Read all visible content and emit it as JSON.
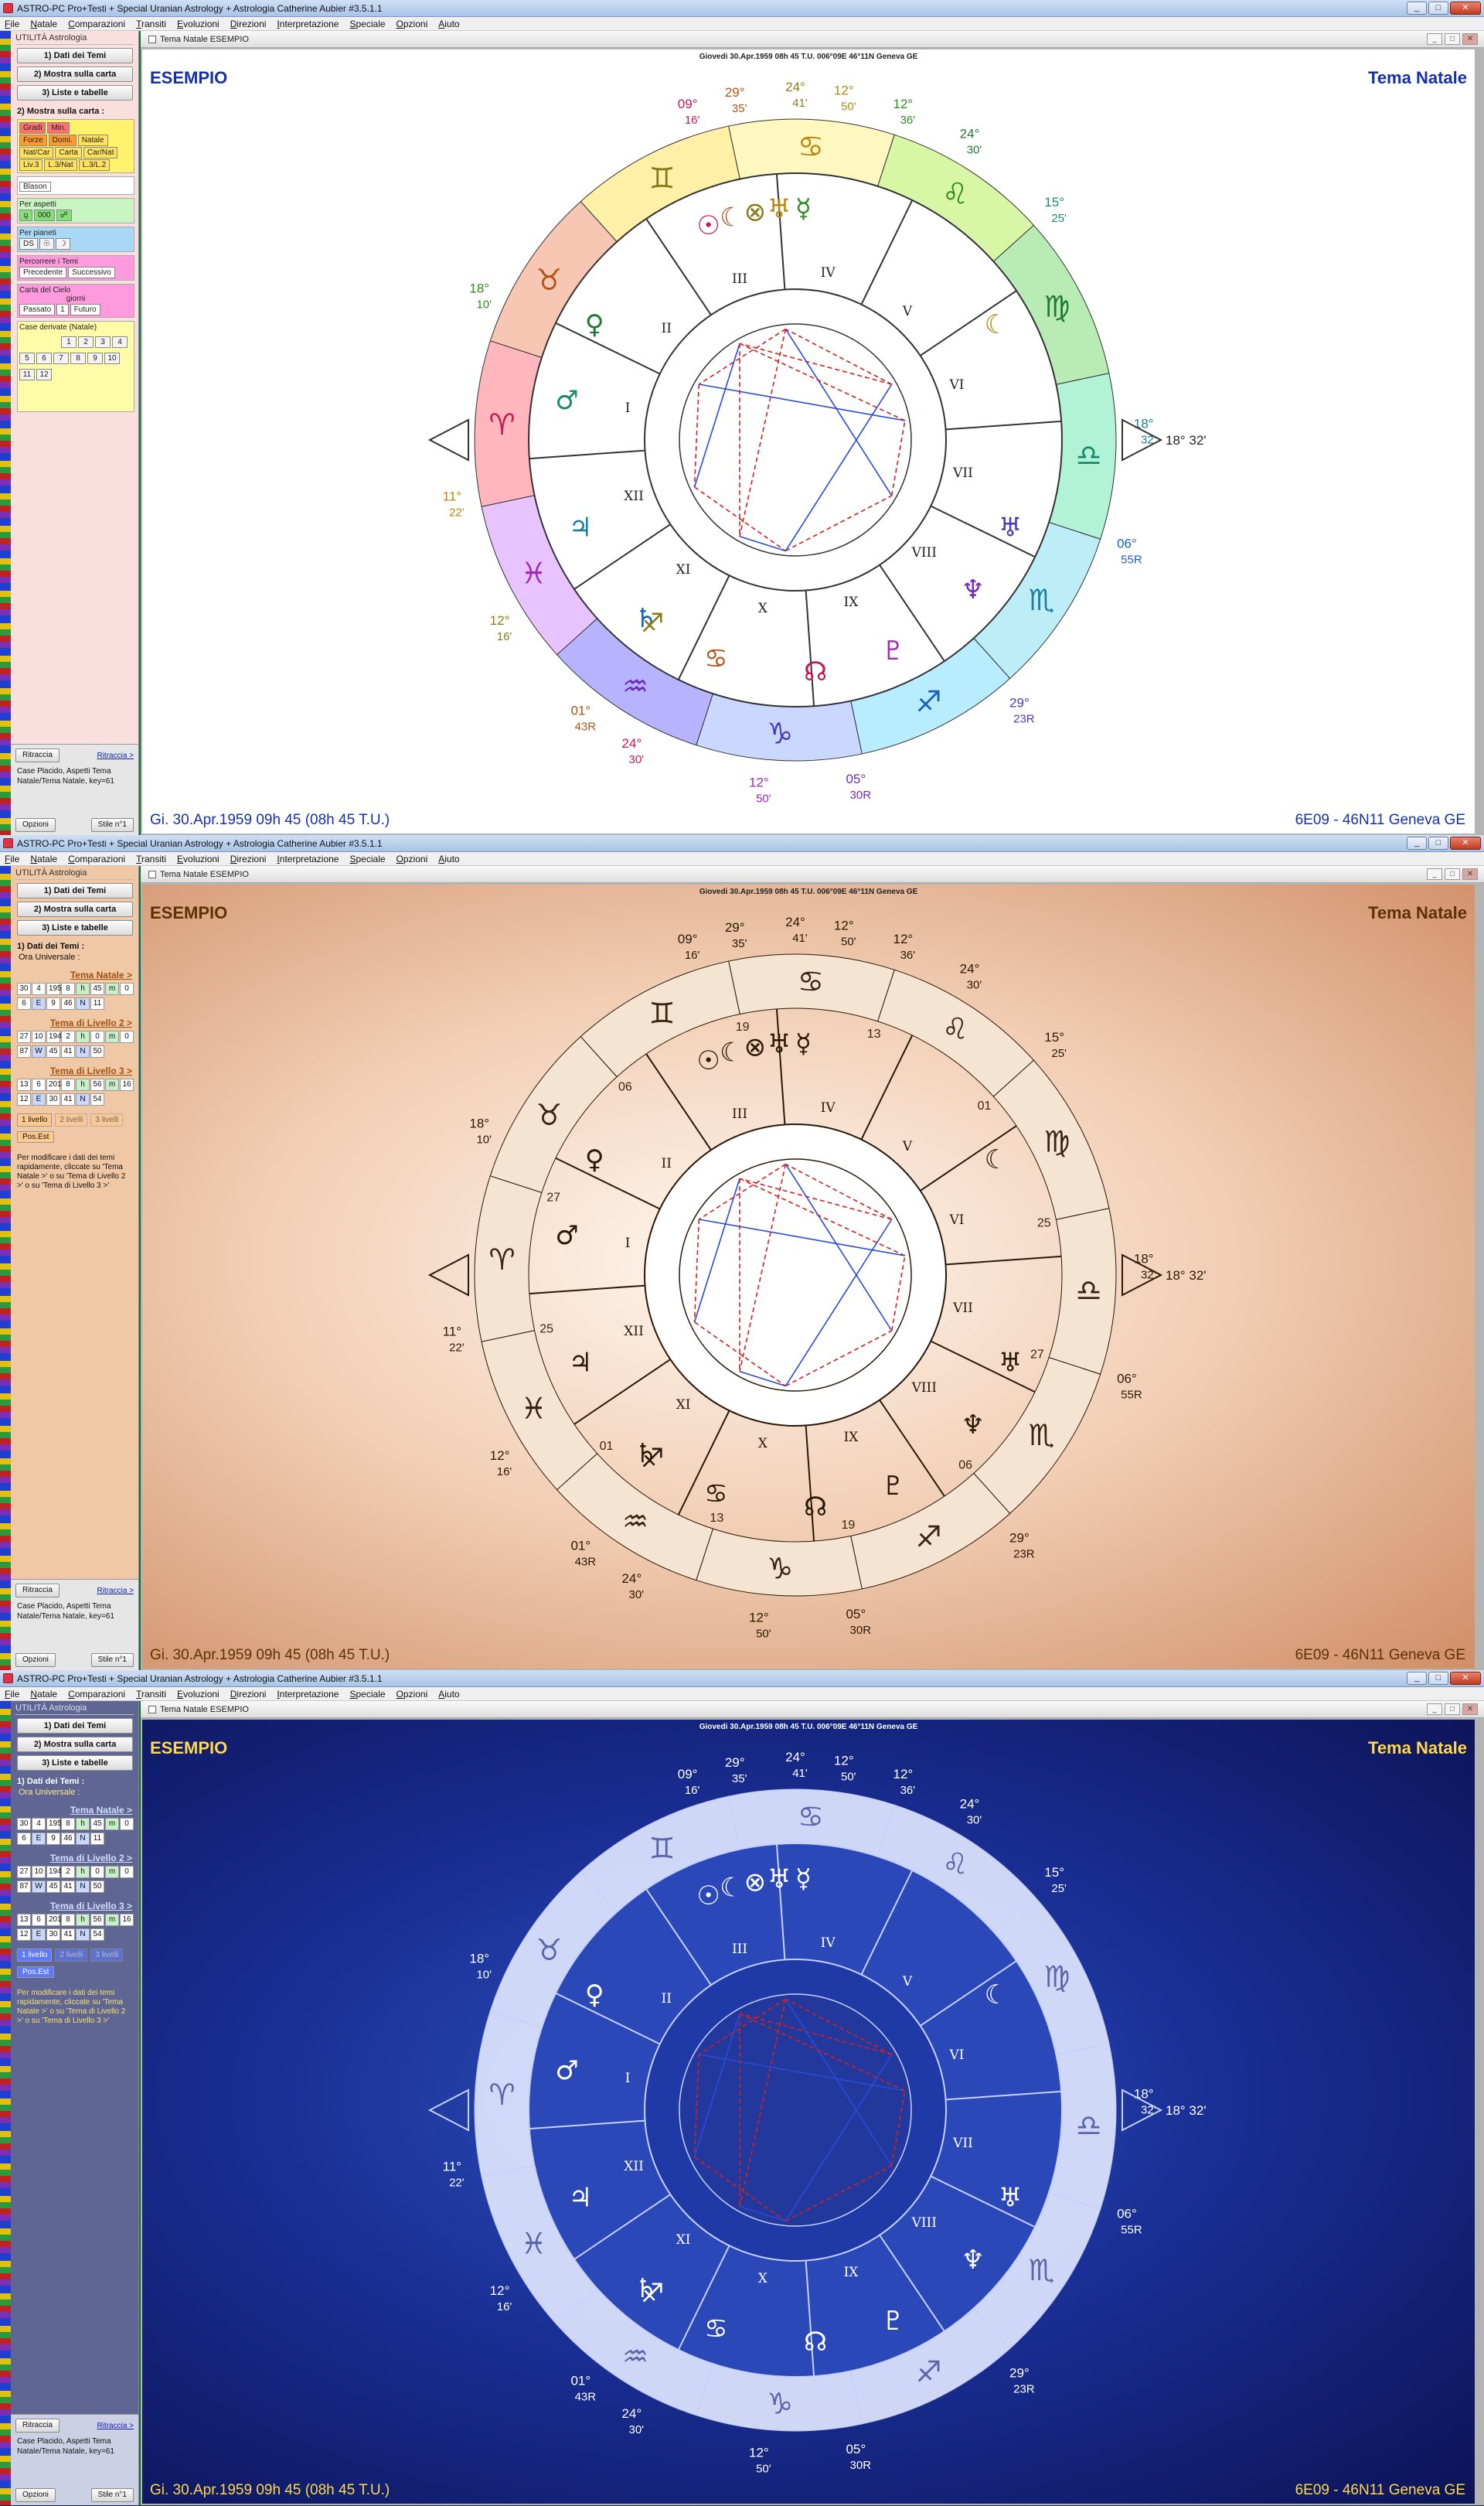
{
  "app": {
    "window_title": "ASTRO-PC Pro+Testi + Special Uranian Astrology + Astrologia Catherine Aubier #3.5.1.1",
    "menu": [
      "File",
      "Natale",
      "Comparazioni",
      "Transiti",
      "Evoluzioni",
      "Direzioni",
      "Interpretazione",
      "Speciale",
      "Opzioni",
      "Aiuto"
    ],
    "window_buttons": {
      "min": "_",
      "max": "□",
      "close": "✕"
    }
  },
  "left_panel": {
    "header": "UTILITÀ Astrologia",
    "nav_buttons": [
      "1) Dati dei Temi",
      "2) Mostra sulla carta",
      "3) Liste e tabelle"
    ],
    "show_section": {
      "title": "2) Mostra sulla carta :",
      "row1": [
        "Gradi",
        "Min."
      ],
      "row2": [
        "Forze",
        "Domi.",
        "Natale"
      ],
      "row3": [
        "Nat/Car",
        "Carta",
        "Car/Nat"
      ],
      "row4": [
        "Liv.3",
        "L.3/Nat",
        "L.3/L.2"
      ],
      "blason": "Blason",
      "aspetti_title": "Per aspetti",
      "aspetti": [
        "⚼",
        "000",
        "☍"
      ],
      "pianeti_title": "Per pianeti",
      "pianeti": [
        "DS",
        "☉",
        "☽"
      ],
      "percorrere_title": "Percorrere i Temi",
      "percorrere": [
        "Precedente",
        "Successivo"
      ],
      "carta_title": "Carta del Cielo",
      "carta_sub": "giorni",
      "carta": [
        "Passato",
        "1",
        "Futuro"
      ],
      "case_title": "Case derivate (Natale)",
      "case_row1": [
        "1",
        "2",
        "3",
        "4"
      ],
      "case_row2": [
        "5",
        "6",
        "7",
        "8",
        "9",
        "10"
      ],
      "case_row3": [
        "11",
        "12"
      ]
    },
    "data_section": {
      "title": "1) Dati dei Temi :",
      "ora": "Ora Universale :",
      "tema_natale": "Tema Natale >",
      "natale_row1": [
        "30",
        "4",
        "1959",
        "8",
        "h",
        "45",
        "m",
        "0"
      ],
      "natale_row2": [
        "6",
        "E",
        "9",
        "46",
        "N",
        "11"
      ],
      "liv2_title": "Tema di Livello 2 >",
      "liv2_row1": [
        "27",
        "10",
        "1947",
        "2",
        "h",
        "0",
        "m",
        "0"
      ],
      "liv2_row2": [
        "87",
        "W",
        "45",
        "41",
        "N",
        "50"
      ],
      "liv3_title": "Tema di Livello 3 >",
      "liv3_row1": [
        "13",
        "6",
        "2013",
        "8",
        "h",
        "56",
        "m",
        "16"
      ],
      "liv3_row2": [
        "12",
        "E",
        "30",
        "41",
        "N",
        "54"
      ],
      "livelli": [
        "1 livello",
        "2 livelli",
        "3 livelli"
      ],
      "pos_est": "Pos.Est",
      "help": "Per modificare i dati dei temi rapidamente, cliccate su 'Tema Natale >' o su 'Tema di Livello 2 >' o su 'Tema di Livello 3 >'"
    },
    "bottom": {
      "ritraccia_btn": "Ritraccia",
      "ritraccia_link": "Ritraccia >",
      "info": "Case Placido, Aspetti Tema Natale/Tema Natale, key=61",
      "opzioni": "Opzioni",
      "stile": "Stile n°1"
    }
  },
  "mdi": {
    "tab_label_1": "Tema Natale ESEMPIO",
    "tab_label_2": "Tema Natale  ESEMPIO",
    "header_line": "Giovedi 30.Apr.1959 08h 45 T.U. 006°09E 46°11N  Geneva GE",
    "top_left": "ESEMPIO",
    "top_right": "Tema Natale",
    "bottom_left": "Gi. 30.Apr.1959 09h 45 (08h 45 T.U.)",
    "bottom_right": "6E09 - 46N11  Geneva GE"
  },
  "wheel": {
    "signs": [
      "♈",
      "♉",
      "♊",
      "♋",
      "♌",
      "♍",
      "♎",
      "♏",
      "♐",
      "♑",
      "♒",
      "♓"
    ],
    "sign_colors": [
      "#ffb6bd",
      "#f7c7b4",
      "#fff0a8",
      "#fff7c0",
      "#d7f6a6",
      "#b8ecb4",
      "#b2f2d6",
      "#bdeef7",
      "#b8ecff",
      "#cad8ff",
      "#b8b3ff",
      "#e7c3ff"
    ],
    "houses": [
      "I",
      "II",
      "III",
      "IV",
      "V",
      "VI",
      "VII",
      "VIII",
      "IX",
      "X",
      "XI",
      "XII"
    ],
    "asc_label": "18° 32'",
    "cusps": [
      {
        "deg": "09°",
        "min": "16'"
      },
      {
        "deg": "29°",
        "min": "35'"
      },
      {
        "deg": "24°",
        "min": "41'"
      },
      {
        "deg": "12°",
        "min": "50'"
      },
      {
        "deg": "12°",
        "min": "36'"
      },
      {
        "deg": "24°",
        "min": "30'"
      },
      {
        "deg": "15°",
        "min": "25'"
      },
      {
        "deg": "18°",
        "min": "32'"
      },
      {
        "deg": "06°",
        "min": "55R"
      },
      {
        "deg": "29°",
        "min": "23R"
      },
      {
        "deg": "05°",
        "min": "30R"
      },
      {
        "deg": "12°",
        "min": "50'"
      },
      {
        "deg": "24°",
        "min": "30'"
      },
      {
        "deg": "01°",
        "min": "43R"
      },
      {
        "deg": "12°",
        "min": "16'"
      },
      {
        "deg": "11°",
        "min": "22'"
      },
      {
        "deg": "18°",
        "min": "10'"
      }
    ],
    "planets": [
      "☉",
      "☾",
      "⊗",
      "♅",
      "☿",
      "♀",
      "♂",
      "♃",
      "♄",
      "♅",
      "♆",
      "♇",
      "☊",
      "♋",
      "♐",
      "☾"
    ],
    "inner_numbers": [
      "25",
      "27",
      "06",
      "19",
      "13",
      "01",
      "25",
      "27",
      "06",
      "19",
      "13",
      "01"
    ]
  }
}
